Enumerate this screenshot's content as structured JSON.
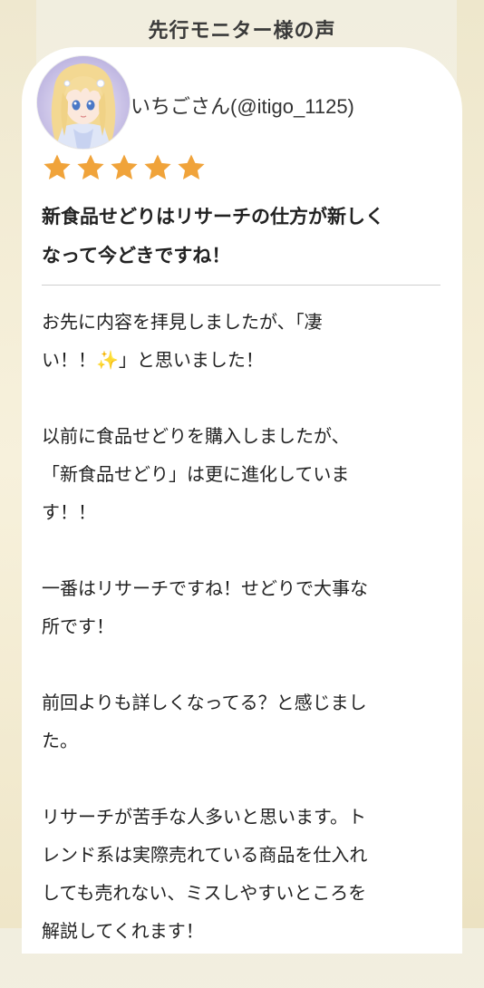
{
  "section_title": "先行モニター様の声",
  "review": {
    "username": "いちごさん(@itigo_1125)",
    "rating": 5,
    "star_color": "#f0a33a",
    "headline": "新食品せどりはリサーチの仕方が新しく\nなって今どきですね！",
    "paragraphs": [
      "お先に内容を拝見しましたが、「凄\nい！！✨」と思いました！",
      "以前に食品せどりを購入しましたが、\n「新食品せどり」は更に進化していま\nす！！",
      "一番はリサーチですね！せどりで大事な\n所です！",
      "前回よりも詳しくなってる？と感じまし\nた。",
      "リサーチが苦手な人多いと思います。ト\nレンド系は実際売れている商品を仕入れ\nしても売れない、ミスしやすいところを\n解説してくれます！"
    ]
  }
}
